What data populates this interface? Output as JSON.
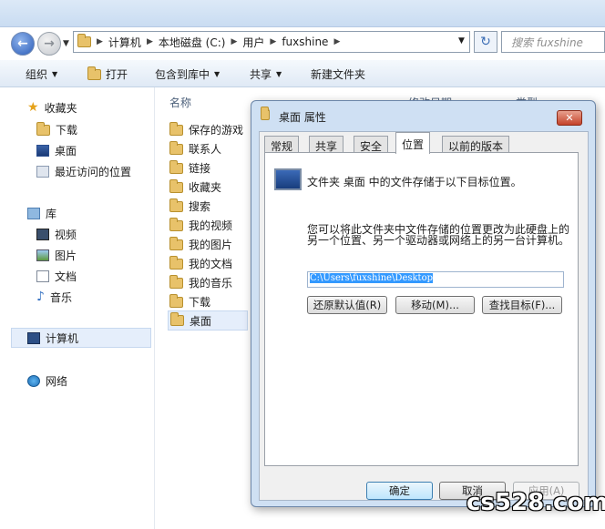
{
  "address_bar": {
    "crumbs": [
      "计算机",
      "本地磁盘 (C:)",
      "用户",
      "fuxshine"
    ],
    "search_placeholder": "搜索 fuxshine"
  },
  "toolbar": {
    "organize": "组织",
    "open": "打开",
    "include_in_library": "包含到库中",
    "share": "共享",
    "new_folder": "新建文件夹"
  },
  "navpane": {
    "favorites": "收藏夹",
    "downloads": "下载",
    "desktop": "桌面",
    "recent": "最近访问的位置",
    "libraries": "库",
    "videos": "视频",
    "pictures": "图片",
    "documents": "文档",
    "music": "音乐",
    "computer": "计算机",
    "network": "网络"
  },
  "file_list": {
    "column_name": "名称",
    "column_date": "修改日期",
    "column_type": "类型",
    "items": [
      "保存的游戏",
      "联系人",
      "链接",
      "收藏夹",
      "搜索",
      "我的视频",
      "我的图片",
      "我的文档",
      "我的音乐",
      "下载",
      "桌面"
    ]
  },
  "dialog": {
    "title": "桌面 属性",
    "tabs": [
      "常规",
      "共享",
      "安全",
      "位置",
      "以前的版本"
    ],
    "active_tab": "位置",
    "description": "文件夹 桌面 中的文件存储于以下目标位置。",
    "explanation": "您可以将此文件夹中文件存储的位置更改为此硬盘上的另一个位置、另一个驱动器或网络上的另一台计算机。",
    "path_value": "C:\\Users\\fuxshine\\Desktop",
    "buttons": {
      "restore_default": "还原默认值(R)",
      "move": "移动(M)...",
      "find_target": "查找目标(F)...",
      "ok": "确定",
      "cancel": "取消",
      "apply": "应用(A)"
    }
  },
  "watermark": "cs528.com"
}
